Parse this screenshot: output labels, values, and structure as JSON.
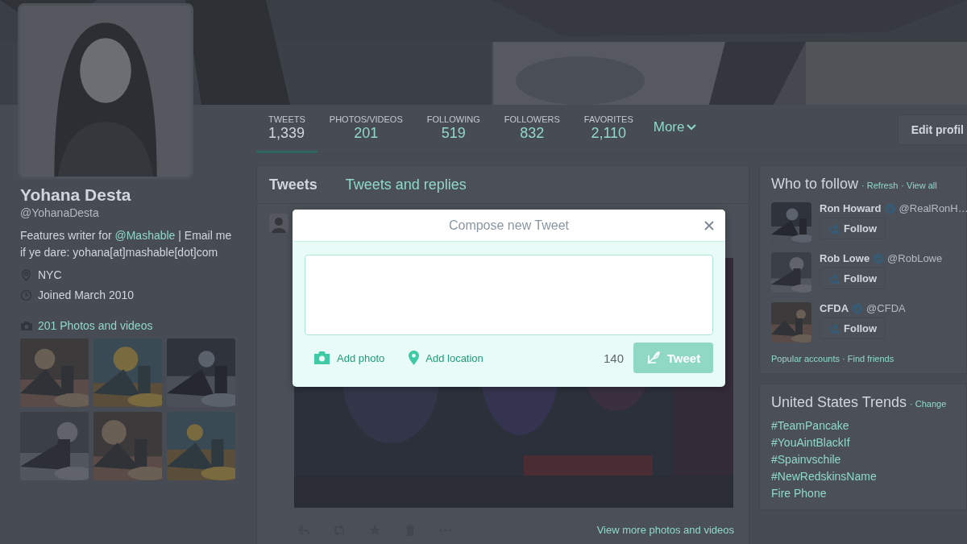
{
  "profile": {
    "name": "Yohana Desta",
    "handle": "@YohanaDesta",
    "bio_before": "Features writer for ",
    "bio_link": "@Mashable",
    "bio_after": " | Email me if ye dare: yohana[at]mashable[dot]com",
    "location": "NYC",
    "joined": "Joined March 2010",
    "photos_link": "201 Photos and videos"
  },
  "stats": [
    {
      "label": "TWEETS",
      "value": "1,339",
      "selected": true
    },
    {
      "label": "PHOTOS/VIDEOS",
      "value": "201",
      "selected": false
    },
    {
      "label": "FOLLOWING",
      "value": "519",
      "selected": false
    },
    {
      "label": "FOLLOWERS",
      "value": "832",
      "selected": false
    },
    {
      "label": "FAVORITES",
      "value": "2,110",
      "selected": false
    }
  ],
  "more": "More",
  "edit_profile": "Edit profil",
  "timeline_tabs": [
    {
      "label": "Tweets",
      "selected": true
    },
    {
      "label": "Tweets and replies",
      "selected": false
    }
  ],
  "tweet": {
    "view_more": "View more photos and videos"
  },
  "who_to_follow": {
    "title": "Who to follow",
    "refresh": "· Refresh",
    "view_all": "· View all",
    "accounts": [
      {
        "name": "Ron Howard",
        "verified": true,
        "handle": "@RealRonH…",
        "follow": "Follow"
      },
      {
        "name": "Rob Lowe",
        "verified": true,
        "handle": "@RobLowe",
        "follow": "Follow"
      },
      {
        "name": "CFDA",
        "verified": true,
        "handle": "@CFDA",
        "follow": "Follow"
      }
    ],
    "popular": "Popular accounts",
    "find_friends": "· Find friends"
  },
  "trends": {
    "title": "United States Trends",
    "change": "· Change",
    "items": [
      "#TeamPancake",
      "#YouAintBlackIf",
      "#Spainvschile",
      "#NewRedskinsName",
      "Fire Phone"
    ]
  },
  "compose": {
    "title": "Compose new Tweet",
    "add_photo": "Add photo",
    "add_location": "Add location",
    "counter": "140",
    "tweet_button": "Tweet",
    "disabled": true
  }
}
